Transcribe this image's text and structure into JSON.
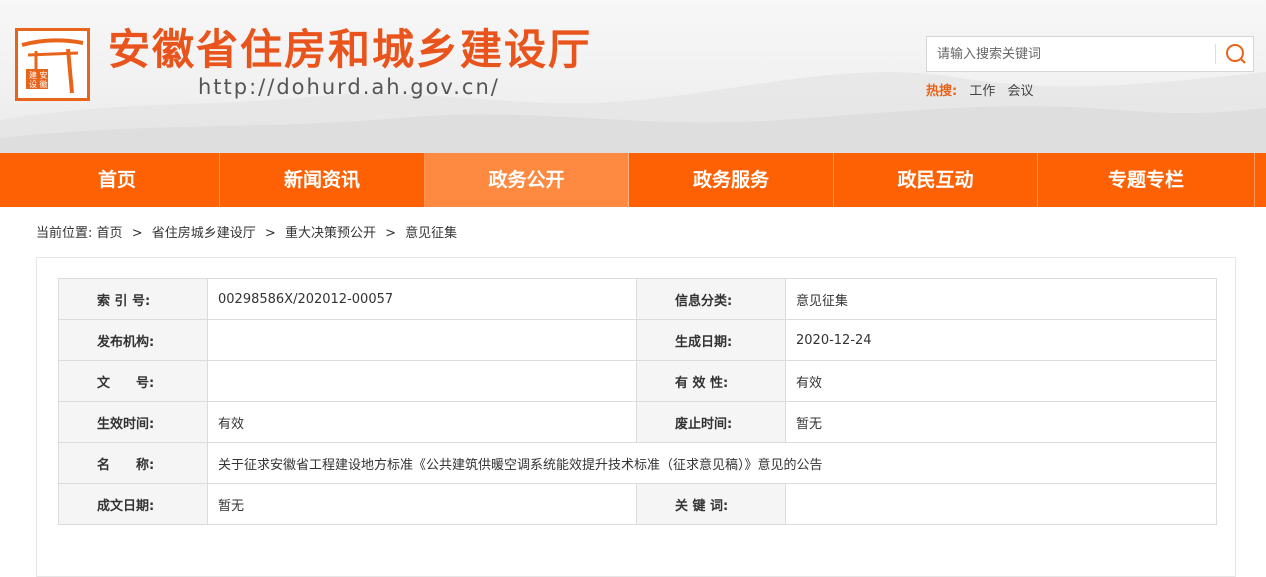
{
  "header": {
    "title": "安徽省住房和城乡建设厅",
    "url": "http://dohurd.ah.gov.cn/",
    "logo_text": "建设安徽",
    "search_placeholder": "请输入搜索关键词",
    "search_icon": "search-icon",
    "hot_label": "热搜:",
    "hot_items": [
      "工作",
      "会议"
    ]
  },
  "colors": {
    "accent": "#e8541b",
    "nav_bg": "#fd6103",
    "nav_active": "#fe8a42"
  },
  "nav": {
    "items": [
      "首页",
      "新闻资讯",
      "政务公开",
      "政务服务",
      "政民互动",
      "专题专栏"
    ],
    "active": "政务公开"
  },
  "breadcrumb": {
    "prefix": "当前位置:",
    "items": [
      "首页",
      "省住房城乡建设厅",
      "重大决策预公开",
      "意见征集"
    ],
    "separator": ">"
  },
  "info": {
    "index_label": "索 引 号:",
    "index_value": "00298586X/202012-00057",
    "category_label": "信息分类:",
    "category_value": "意见征集",
    "publisher_label": "发布机构:",
    "publisher_value": "",
    "created_label": "生成日期:",
    "created_value": "2020-12-24",
    "docno_label": "文　　号:",
    "docno_value": "",
    "validity_label": "有 效 性:",
    "validity_value": "有效",
    "effective_label": "生效时间:",
    "effective_value": "有效",
    "repeal_label": "废止时间:",
    "repeal_value": "暂无",
    "name_label": "名　　称:",
    "name_value": "关于征求安徽省工程建设地方标准《公共建筑供暖空调系统能效提升技术标准（征求意见稿）》意见的公告",
    "written_label": "成文日期:",
    "written_value": "暂无",
    "keywords_label": "关 键 词:",
    "keywords_value": ""
  }
}
